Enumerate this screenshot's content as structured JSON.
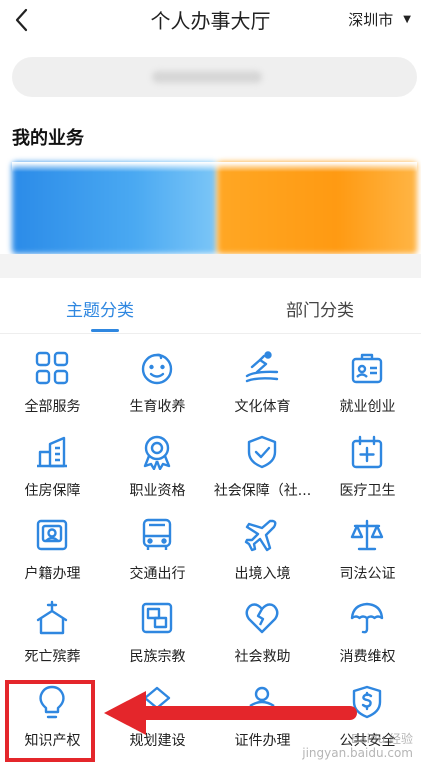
{
  "header": {
    "title": "个人办事大厅",
    "city": "深圳市",
    "city_caret": "▼"
  },
  "section": {
    "my_business": "我的业务"
  },
  "tabs": [
    {
      "label": "主题分类",
      "active": true
    },
    {
      "label": "部门分类",
      "active": false
    }
  ],
  "services": [
    {
      "label": "全部服务",
      "icon": "grid-icon"
    },
    {
      "label": "生育收养",
      "icon": "baby-face-icon"
    },
    {
      "label": "文化体育",
      "icon": "sport-icon"
    },
    {
      "label": "就业创业",
      "icon": "briefcase-icon"
    },
    {
      "label": "住房保障",
      "icon": "building-icon"
    },
    {
      "label": "职业资格",
      "icon": "award-icon"
    },
    {
      "label": "社会保障（社...",
      "icon": "shield-check-icon"
    },
    {
      "label": "医疗卫生",
      "icon": "medical-icon"
    },
    {
      "label": "户籍办理",
      "icon": "id-photo-icon"
    },
    {
      "label": "交通出行",
      "icon": "bus-icon"
    },
    {
      "label": "出境入境",
      "icon": "plane-icon"
    },
    {
      "label": "司法公证",
      "icon": "scales-icon"
    },
    {
      "label": "死亡殡葬",
      "icon": "church-icon"
    },
    {
      "label": "民族宗教",
      "icon": "windows-icon"
    },
    {
      "label": "社会救助",
      "icon": "heart-icon"
    },
    {
      "label": "消费维权",
      "icon": "umbrella-icon"
    },
    {
      "label": "知识产权",
      "icon": "lightbulb-icon"
    },
    {
      "label": "规划建设",
      "icon": "planning-icon"
    },
    {
      "label": "证件办理",
      "icon": "person-icon"
    },
    {
      "label": "公共安全",
      "icon": "dollar-shield-icon"
    }
  ],
  "watermark": {
    "line1": "Baidu 经验",
    "line2": "jingyan.baidu.com"
  },
  "colors": {
    "accent": "#2f87e0",
    "highlight": "#e4262b",
    "card_blue": "#3b9bee",
    "card_orange": "#ff9f1a"
  }
}
